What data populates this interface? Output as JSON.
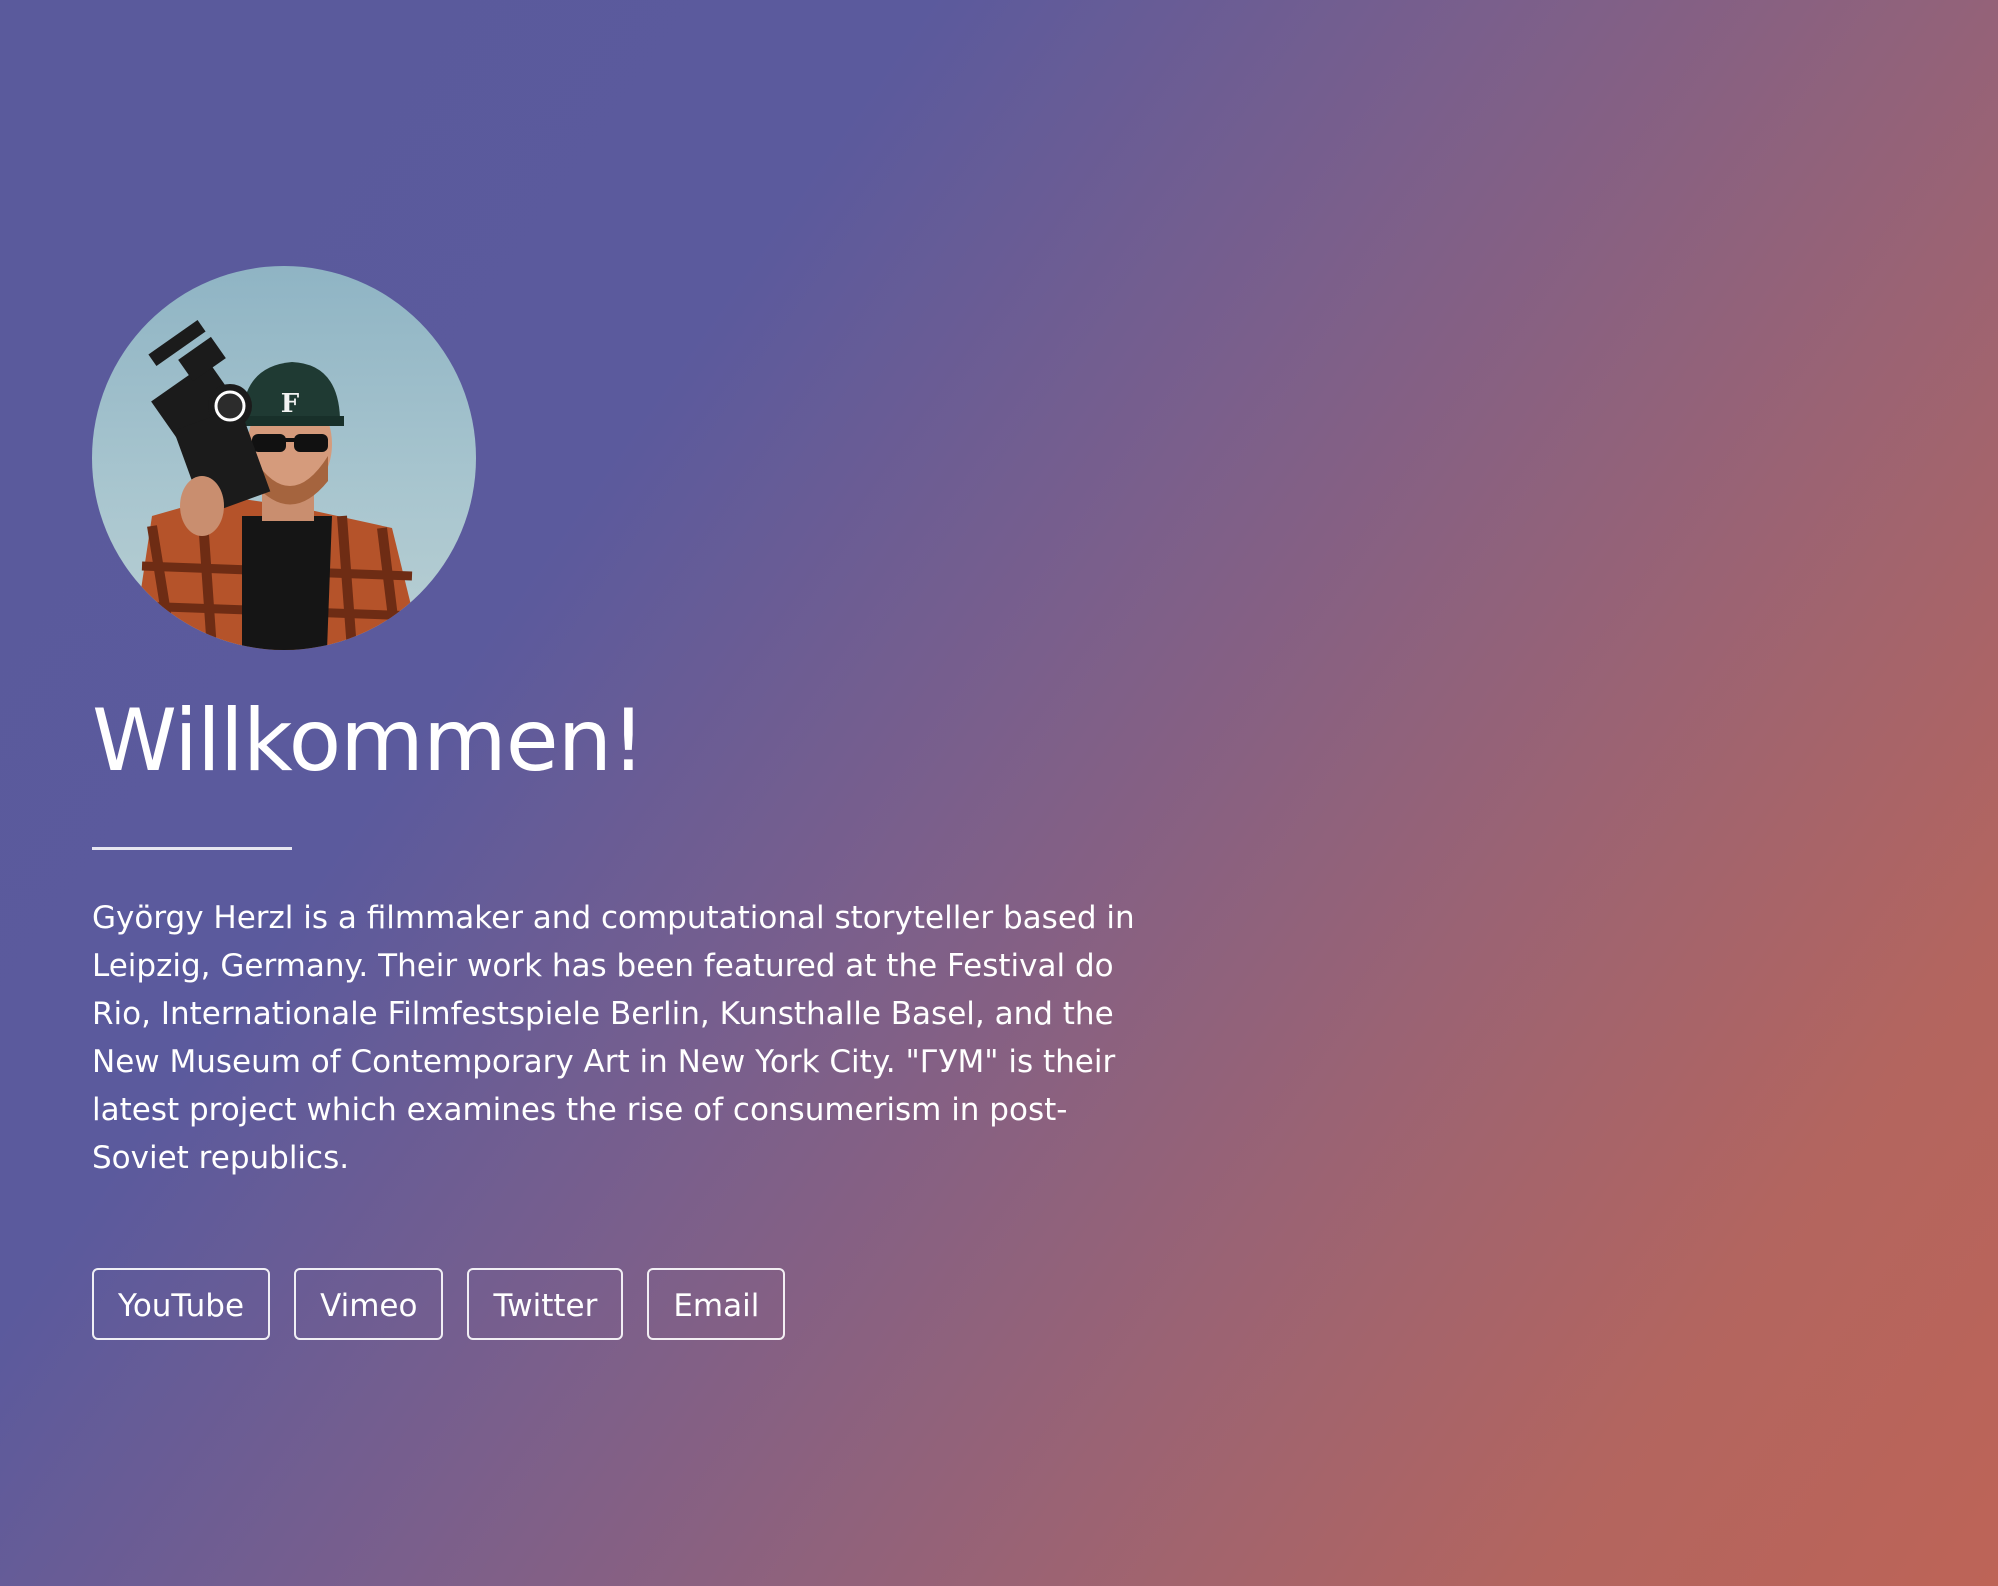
{
  "profile": {
    "avatar_icon": "portrait-photo-icon",
    "title": "Willkommen!",
    "bio": "György Herzl is a filmmaker and computational storyteller based in Leipzig, Germany. Their work has been featured at the Festival do Rio, Internationale Filmfestspiele Berlin, Kunsthalle Basel, and the New Museum of Contemporary Art in New York City. \"ГУМ\" is their latest project which examines the rise of consumerism in post-Soviet republics."
  },
  "links": [
    {
      "label": "YouTube"
    },
    {
      "label": "Vimeo"
    },
    {
      "label": "Twitter"
    },
    {
      "label": "Email"
    }
  ],
  "colors": {
    "gradient_start": "#5a5a9c",
    "gradient_end": "#bd6457",
    "text": "#ffffff"
  }
}
